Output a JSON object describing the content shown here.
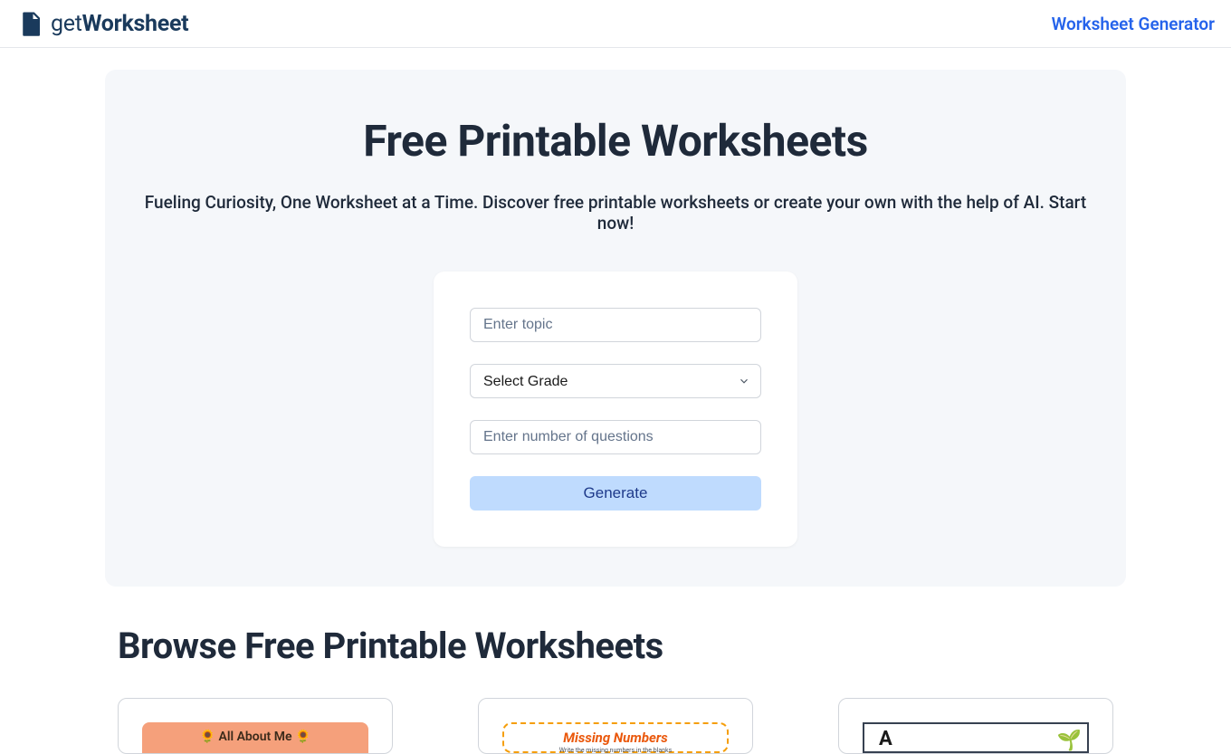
{
  "header": {
    "logo_get": "get",
    "logo_worksheet": "Worksheet",
    "nav_link": "Worksheet Generator"
  },
  "hero": {
    "title": "Free Printable Worksheets",
    "subtitle": "Fueling Curiosity, One Worksheet at a Time. Discover free printable worksheets or create your own with the help of AI. Start now!"
  },
  "form": {
    "topic_placeholder": "Enter topic",
    "grade_selected": "Select Grade",
    "questions_placeholder": "Enter number of questions",
    "generate_label": "Generate"
  },
  "browse": {
    "title": "Browse Free Printable Worksheets",
    "cards": [
      {
        "preview_title": "🌻 All About Me 🌻"
      },
      {
        "preview_title": "Missing Numbers",
        "preview_sub": "Write the missing numbers in the blanks"
      },
      {
        "preview_letter": "A",
        "preview_emoji": "🌱"
      }
    ]
  }
}
